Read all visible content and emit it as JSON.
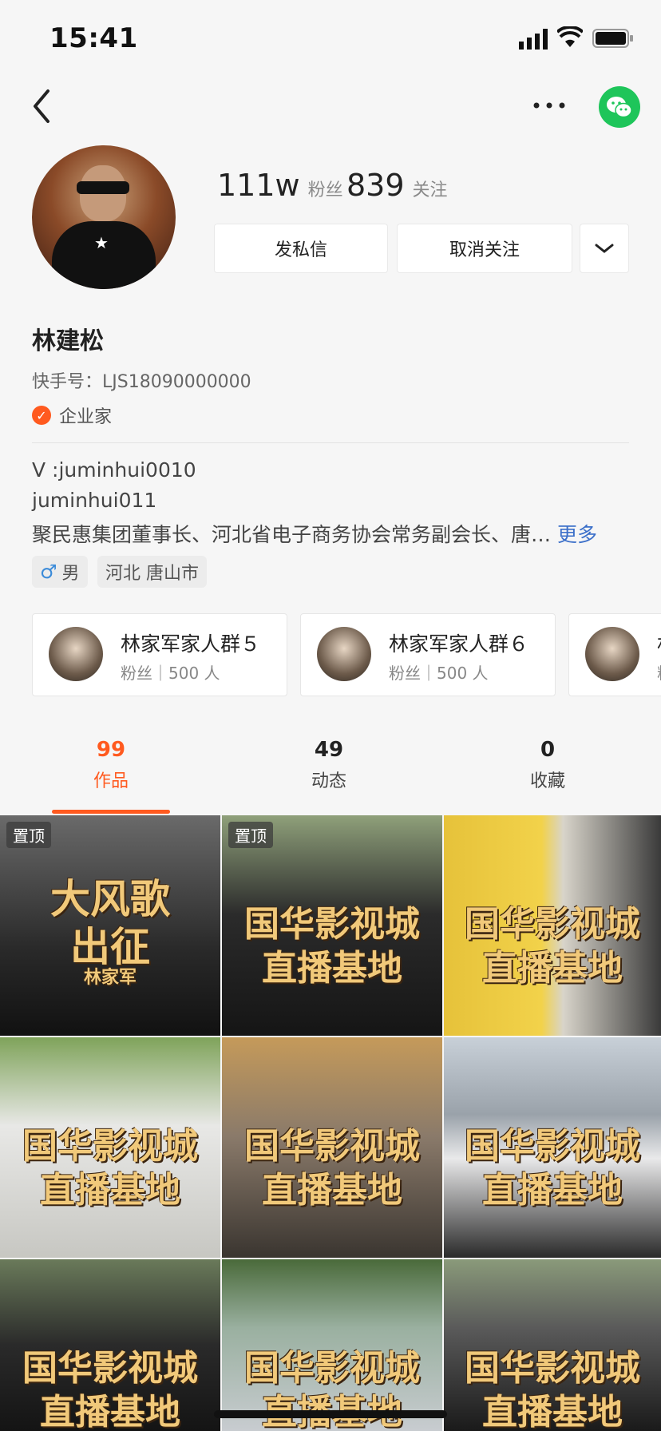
{
  "status_bar": {
    "time": "15:41"
  },
  "header": {
    "back_icon": "chevron-left-icon",
    "more_icon": "ellipsis-icon",
    "share_icon": "wechat-icon",
    "share_color": "#1ec55a"
  },
  "profile": {
    "fans_count": "111w",
    "fans_label": "粉丝",
    "following_count": "839",
    "following_label": "关注",
    "message_button": "发私信",
    "unfollow_button": "取消关注",
    "name": "林建松",
    "kuaishou_id": "快手号：LJS18090000000",
    "badge_label": "企业家",
    "bio_line1": "V :juminhui0010",
    "bio_line2": "juminhui011",
    "bio_line3": "聚民惠集团董事长、河北省电子商务协会常务副会长、唐…",
    "bio_more": "更多",
    "gender": "男",
    "location": "河北 唐山市"
  },
  "groups": [
    {
      "name": "林家军家人群５",
      "sub": "粉丝｜500 人"
    },
    {
      "name": "林家军家人群６",
      "sub": "粉丝｜500 人"
    },
    {
      "name": "林",
      "sub": "粉"
    }
  ],
  "tabs": [
    {
      "count": "99",
      "label": "作品"
    },
    {
      "count": "49",
      "label": "动态"
    },
    {
      "count": "0",
      "label": "收藏"
    }
  ],
  "accent_color": "#ff5a1f",
  "videos": [
    {
      "pin": "置顶",
      "line1": "大风歌",
      "line2": "出征",
      "line3": "林家军"
    },
    {
      "pin": "置顶",
      "line1": "国华影视城",
      "line2": "直播基地"
    },
    {
      "line1": "国华影视城",
      "line2": "直播基地"
    },
    {
      "line1": "国华影视城",
      "line2": "直播基地"
    },
    {
      "line1": "国华影视城",
      "line2": "直播基地"
    },
    {
      "line1": "国华影视城",
      "line2": "直播基地"
    },
    {
      "line1": "国华影视城",
      "line2": "直播基地"
    },
    {
      "line1": "国华影视城",
      "line2": "直播基地"
    },
    {
      "line1": "国华影视城",
      "line2": "直播基地"
    }
  ]
}
